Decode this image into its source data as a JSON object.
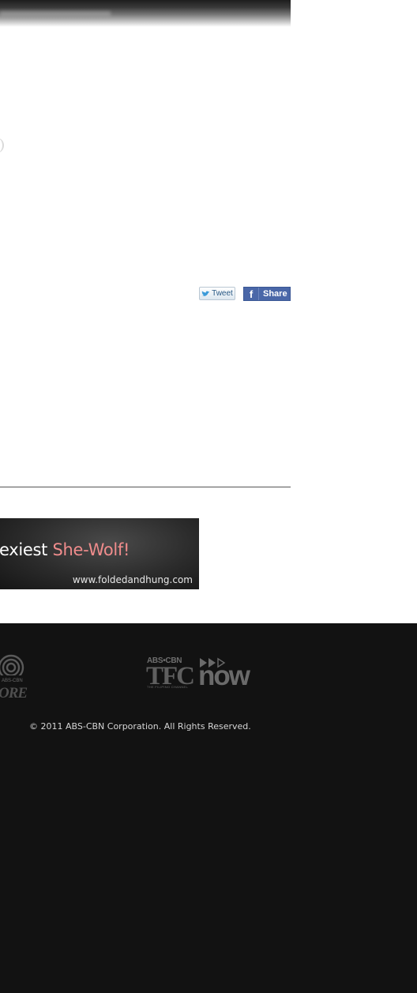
{
  "share": {
    "tweet_label": "Tweet",
    "facebook_label": "Share",
    "facebook_glyph": "f",
    "tweet_icon": "twitter-bird-icon",
    "facebook_icon": "facebook-icon"
  },
  "banner": {
    "headline_prefix": "exiest",
    "headline_accent": "She-Wolf!",
    "url": "www.foldedandhung.com",
    "accent_color": "#f08c8c"
  },
  "footer": {
    "store_logo_text": "ABS-CBN STORE",
    "store_logo_visible_text": "ORE",
    "store_logo_small_text": "ABS-CBN",
    "tfc_brand_top": "ABS•CBN",
    "tfc_brand_main": "TFC",
    "tfc_tagline": "THE FILIPINO CHANNEL",
    "tfc_now": "now",
    "copyright": "© 2011 ABS-CBN Corporation. All Rights Reserved.",
    "background": "#121212"
  }
}
